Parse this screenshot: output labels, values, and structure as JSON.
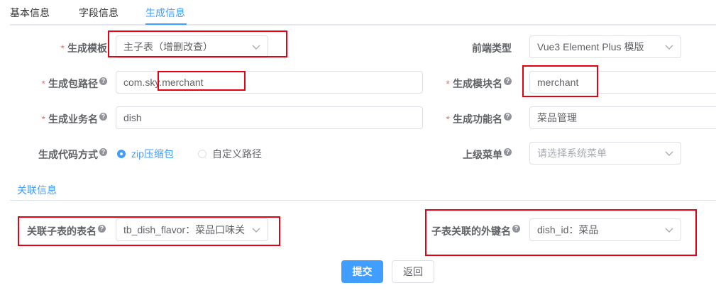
{
  "tabs": [
    "基本信息",
    "字段信息",
    "生成信息"
  ],
  "form": {
    "gen_template": {
      "label": "生成模板",
      "value": "主子表（增删改查）"
    },
    "frontend_type": {
      "label": "前端类型",
      "value": "Vue3 Element Plus 模版"
    },
    "package_path": {
      "label": "生成包路径",
      "value": "com.sky.merchant"
    },
    "module_name": {
      "label": "生成模块名",
      "value": "merchant"
    },
    "business_name": {
      "label": "生成业务名",
      "value": "dish"
    },
    "function_name": {
      "label": "生成功能名",
      "value": "菜品管理"
    },
    "gen_type": {
      "label": "生成代码方式",
      "options": [
        "zip压缩包",
        "自定义路径"
      ],
      "selected": "zip压缩包"
    },
    "parent_menu": {
      "label": "上级菜单",
      "placeholder": "请选择系统菜单"
    }
  },
  "related": {
    "section_title": "关联信息",
    "sub_table": {
      "label": "关联子表的表名",
      "value": "tb_dish_flavor：菜品口味关"
    },
    "fk": {
      "label": "子表关联的外键名",
      "value": "dish_id：菜品"
    }
  },
  "buttons": {
    "submit": "提交",
    "back": "返回"
  },
  "help_glyph": "?",
  "required_mark": "*",
  "colors": {
    "accent": "#409eff",
    "required": "#f56c6c",
    "highlight": "#e60012"
  }
}
